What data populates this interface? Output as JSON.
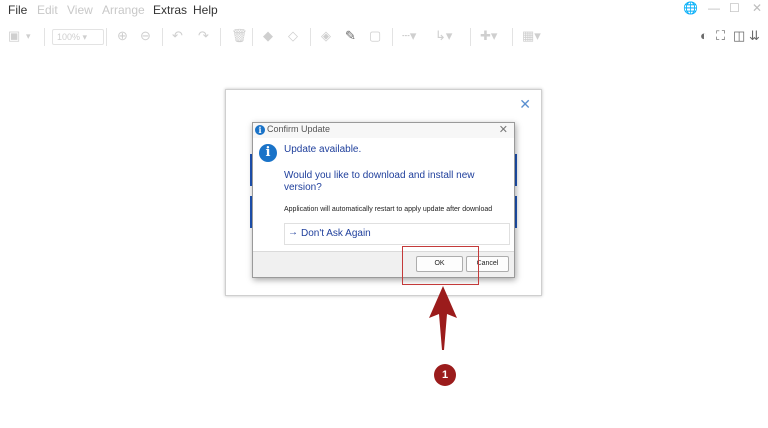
{
  "menu": {
    "items": [
      "File",
      "Edit",
      "View",
      "Arrange",
      "Extras",
      "Help"
    ]
  },
  "toolbar": {
    "zoom": "100%"
  },
  "dialog": {
    "title": "Confirm Update",
    "main_instruction": "Update available.",
    "content_text": "Would you like to download and install new version?",
    "expanded_info": "Application will automatically restart to apply update after download",
    "command_link": "Don't Ask Again",
    "ok_label": "OK",
    "cancel_label": "Cancel"
  },
  "annotation": {
    "step_number": "1",
    "color": "#9b1c1c"
  },
  "colors": {
    "accent": "#1a73c8",
    "text_blue": "#1f3f9c",
    "highlight_red": "#c43a3a"
  }
}
